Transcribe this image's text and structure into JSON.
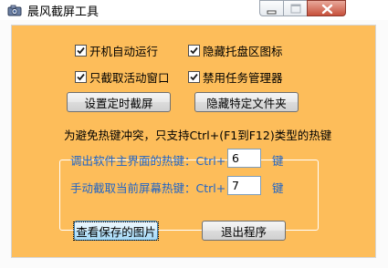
{
  "window": {
    "title": "晨风截屏工具"
  },
  "options": {
    "autostart": {
      "label": "开机自动运行",
      "checked": true
    },
    "hide_tray": {
      "label": "隐藏托盘区图标",
      "checked": true
    },
    "active_window_only": {
      "label": "只截取活动窗口",
      "checked": true
    },
    "disable_taskmgr": {
      "label": "禁用任务管理器",
      "checked": true
    }
  },
  "buttons": {
    "set_timer": "设置定时截屏",
    "hide_folder": "隐藏特定文件夹",
    "view_saved": "查看保存的图片",
    "exit": "退出程序"
  },
  "hotkeys": {
    "caption": "为避免热键冲突，只支持Ctrl+(F1到F12)类型的热键",
    "main_window": {
      "label": "调出软件主界面的热键：Ctrl+ F",
      "value": "6",
      "suffix": "键"
    },
    "capture": {
      "label": "手动截取当前屏幕热键：Ctrl+ F",
      "value": "7",
      "suffix": "键"
    }
  },
  "icons": {
    "app": "camera-icon",
    "minimize": "minimize-icon",
    "maximize": "maximize-icon",
    "close": "close-icon"
  },
  "colors": {
    "panel": "#fdbd5a",
    "hotkey_text": "#1e64c8",
    "close_button": "#c7503b"
  }
}
